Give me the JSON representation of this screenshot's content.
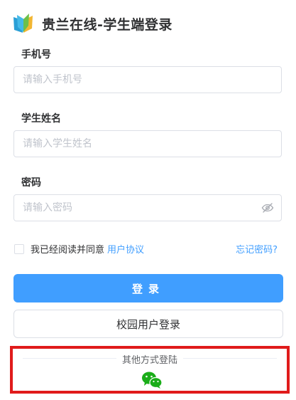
{
  "header": {
    "title": "贵兰在线-学生端登录",
    "logo_icon": "book-logo-icon"
  },
  "form": {
    "phone": {
      "label": "手机号",
      "placeholder": "请输入手机号",
      "value": ""
    },
    "name": {
      "label": "学生姓名",
      "placeholder": "请输入学生姓名",
      "value": ""
    },
    "password": {
      "label": "密码",
      "placeholder": "请输入密码",
      "value": "",
      "toggle_icon": "eye-off-icon"
    },
    "agreement": {
      "checked": false,
      "text": "我已经阅读并同意",
      "link": "用户协议"
    },
    "forgot": "忘记密码?"
  },
  "buttons": {
    "login": "登录",
    "campus_login": "校园用户登录"
  },
  "other_login": {
    "title": "其他方式登陆",
    "wechat_icon": "wechat-icon"
  },
  "colors": {
    "primary": "#409eff",
    "highlight_border": "#e01b1b",
    "wechat": "#1aad19"
  }
}
